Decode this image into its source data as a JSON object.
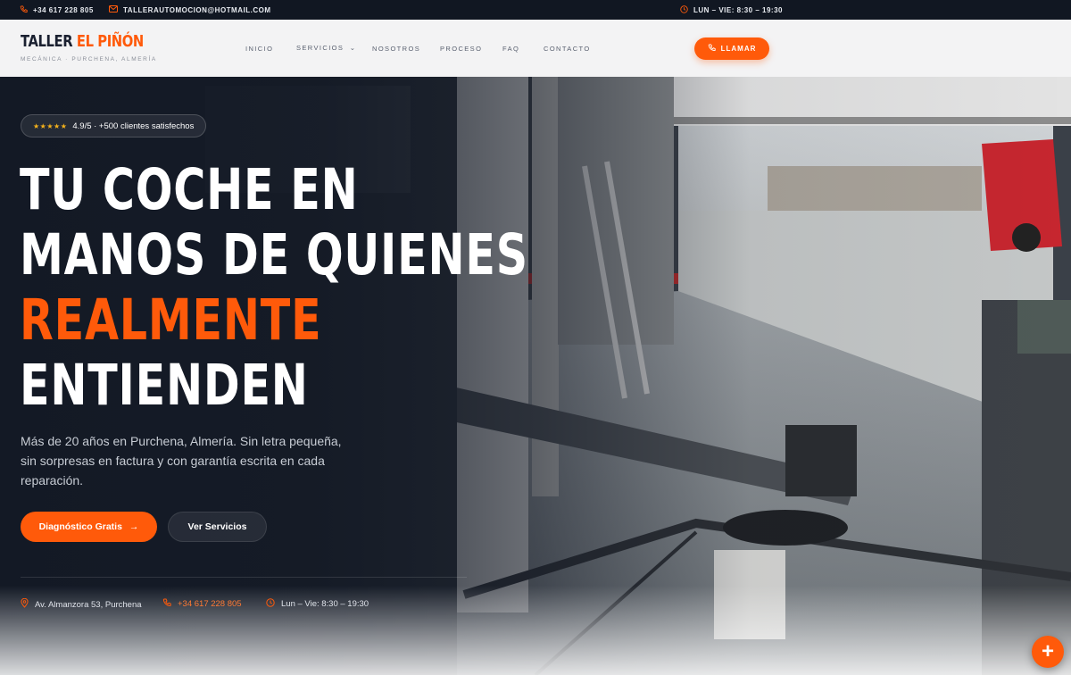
{
  "topbar": {
    "phone": "+34 617 228 805",
    "email": "TALLERAUTOMOCION@HOTMAIL.COM",
    "hours": "LUN – VIE: 8:30 – 19:30"
  },
  "brand": {
    "name_part1": "TALLER",
    "name_part2": "EL PIÑÓN",
    "tagline": "MECÁNICA · PURCHENA, ALMERÍA"
  },
  "nav": {
    "items": [
      "INICIO",
      "SERVICIOS",
      "NOSOTROS",
      "PROCESO",
      "FAQ",
      "CONTACTO"
    ],
    "services_caret": "⌄",
    "call_label": "LLAMAR"
  },
  "hero": {
    "rating_stars": "★★★★★",
    "rating_text": "4.9/5 · +500 clientes satisfechos",
    "headline": {
      "line1": "TU COCHE EN",
      "line2": "MANOS DE QUIENES",
      "line3": "REALMENTE",
      "line4": "ENTIENDEN"
    },
    "lead": "Más de 20 años en Purchena, Almería. Sin letra pequeña, sin sorpresas en factura y con garantía escrita en cada reparación.",
    "primary_cta": "Diagnóstico Gratis",
    "primary_cta_arrow": "→",
    "secondary_cta": "Ver Servicios",
    "info": {
      "address": "Av. Almanzora 53, Purchena",
      "phone": "+34 617 228 805",
      "hours": "Lun – Vie: 8:30 – 19:30"
    }
  },
  "fab": {
    "label": "+"
  },
  "colors": {
    "accent": "#ff5a0a",
    "dark": "#111722",
    "nav_bg": "#f3f3f4",
    "stars": "#f5b21b"
  },
  "icons": {
    "phone": "phone-icon",
    "email": "mail-icon",
    "clock": "clock-icon",
    "pin": "map-pin-icon",
    "arrow": "arrow-right-icon",
    "plus": "plus-icon"
  }
}
